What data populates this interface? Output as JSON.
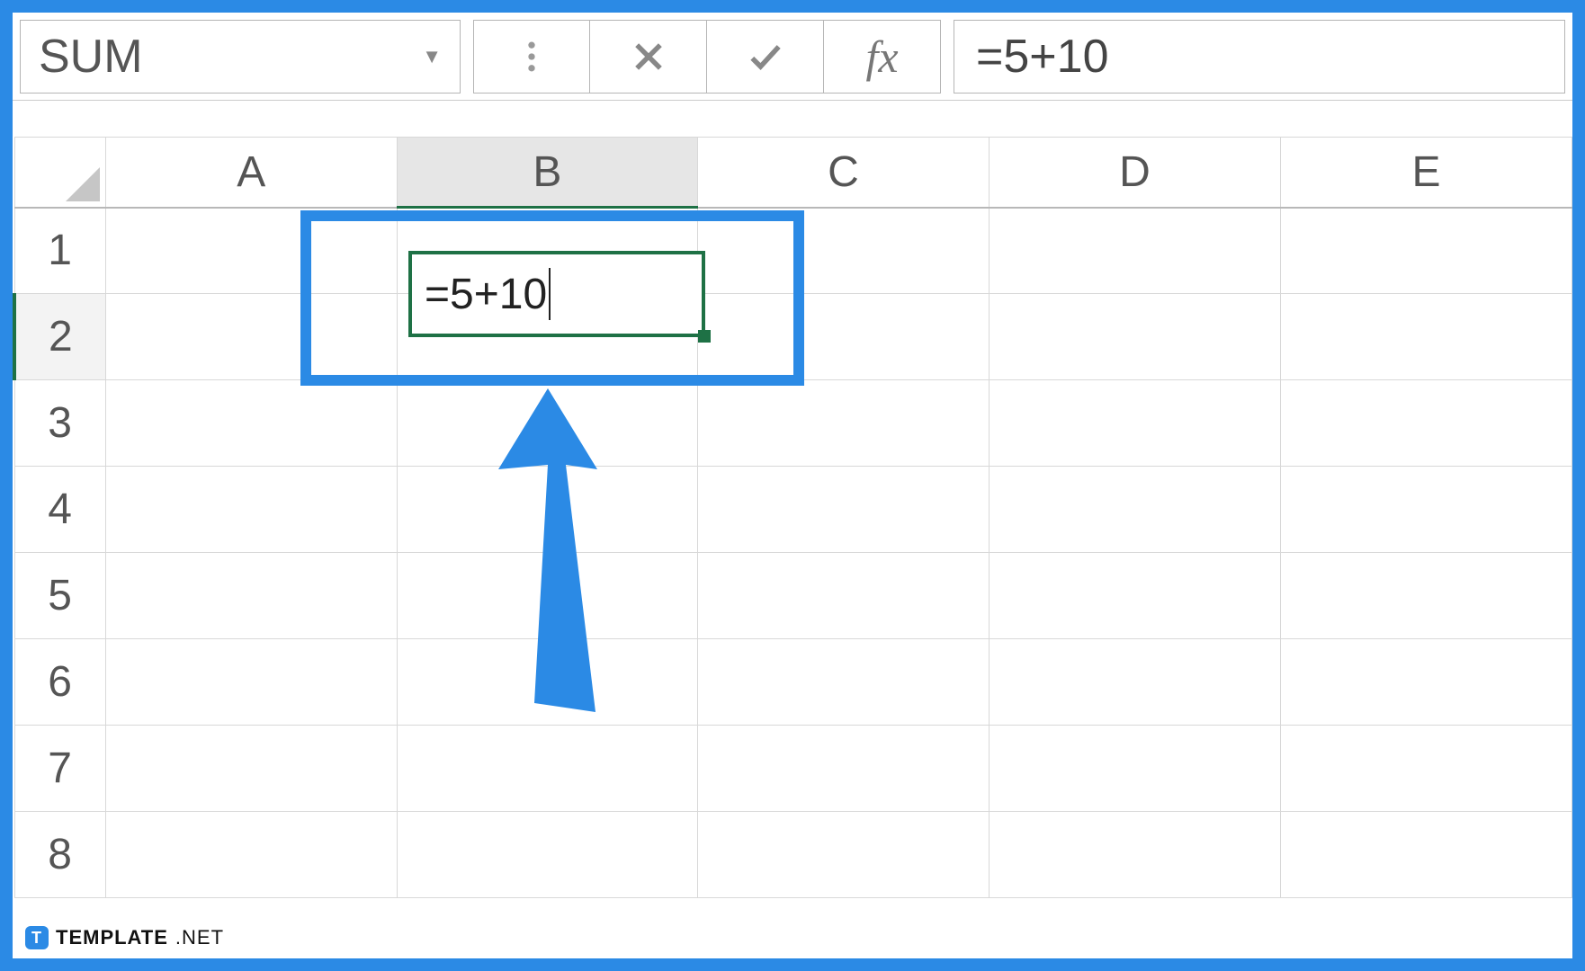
{
  "formula_bar": {
    "name_box": "SUM",
    "formula": "=5+10"
  },
  "columns": [
    "A",
    "B",
    "C",
    "D",
    "E"
  ],
  "rows": [
    "1",
    "2",
    "3",
    "4",
    "5",
    "6",
    "7",
    "8"
  ],
  "active_cell": {
    "ref": "B2",
    "value": "=5+10"
  },
  "watermark": {
    "brand": "TEMPLATE",
    "suffix": ".NET"
  }
}
